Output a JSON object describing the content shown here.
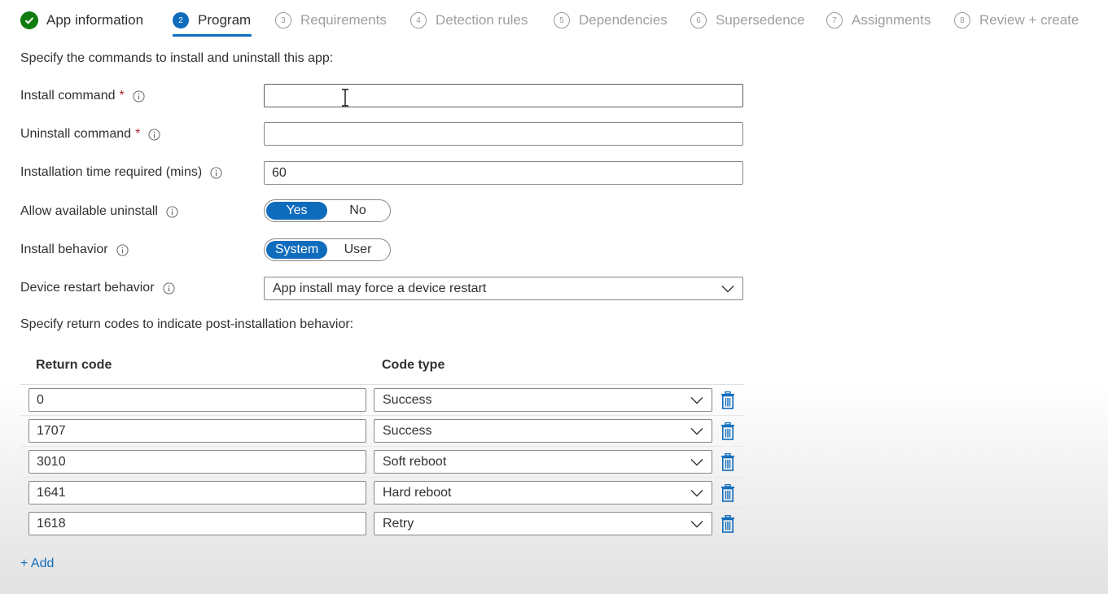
{
  "wizard": {
    "steps": [
      {
        "num": "✓",
        "label": "App information"
      },
      {
        "num": "2",
        "label": "Program"
      },
      {
        "num": "3",
        "label": "Requirements"
      },
      {
        "num": "4",
        "label": "Detection rules"
      },
      {
        "num": "5",
        "label": "Dependencies"
      },
      {
        "num": "6",
        "label": "Supersedence"
      },
      {
        "num": "7",
        "label": "Assignments"
      },
      {
        "num": "8",
        "label": "Review + create"
      }
    ]
  },
  "form": {
    "intro": "Specify the commands to install and uninstall this app:",
    "install_command": {
      "label": "Install command",
      "required_mark": "*",
      "value": ""
    },
    "uninstall_command": {
      "label": "Uninstall command",
      "required_mark": "*",
      "value": ""
    },
    "install_time": {
      "label": "Installation time required (mins)",
      "value": "60"
    },
    "allow_uninstall": {
      "label": "Allow available uninstall",
      "options": [
        "Yes",
        "No"
      ],
      "selected": "Yes"
    },
    "install_behavior": {
      "label": "Install behavior",
      "options": [
        "System",
        "User"
      ],
      "selected": "System"
    },
    "restart_behavior": {
      "label": "Device restart behavior",
      "value": "App install may force a device restart"
    },
    "return_codes_intro": "Specify return codes to indicate post-installation behavior:"
  },
  "return_codes": {
    "headers": {
      "code": "Return code",
      "type": "Code type"
    },
    "rows": [
      {
        "code": "0",
        "type": "Success"
      },
      {
        "code": "1707",
        "type": "Success"
      },
      {
        "code": "3010",
        "type": "Soft reboot"
      },
      {
        "code": "1641",
        "type": "Hard reboot"
      },
      {
        "code": "1618",
        "type": "Retry"
      }
    ],
    "add_label": "+ Add"
  },
  "colors": {
    "accent": "#0f6cbd",
    "success": "#107c10",
    "required": "#a4262c"
  }
}
